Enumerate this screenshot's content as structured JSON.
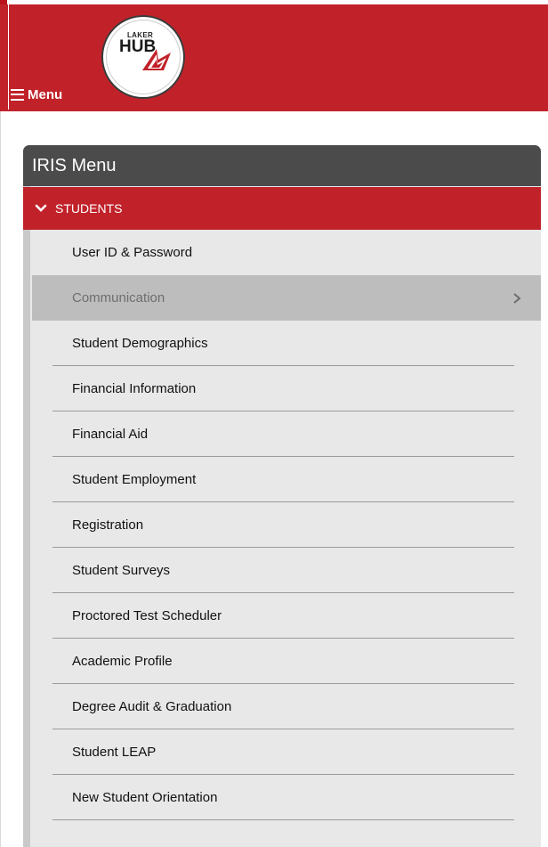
{
  "header": {
    "menu_label": "Menu",
    "logo": {
      "top_text": "LAKER",
      "main_text": "HUB"
    },
    "colors": {
      "brand_red": "#c1222a",
      "white": "#ffffff"
    }
  },
  "panel": {
    "title": "IRIS Menu",
    "section": {
      "label": "STUDENTS",
      "expanded": true
    },
    "items": [
      {
        "label": "User ID & Password"
      },
      {
        "label": "Communication",
        "active": true
      },
      {
        "label": "Student Demographics"
      },
      {
        "label": "Financial Information"
      },
      {
        "label": "Financial Aid"
      },
      {
        "label": "Student Employment"
      },
      {
        "label": "Registration"
      },
      {
        "label": "Student Surveys"
      },
      {
        "label": "Proctored Test Scheduler"
      },
      {
        "label": "Academic Profile"
      },
      {
        "label": "Degree Audit & Graduation"
      },
      {
        "label": "Student LEAP"
      },
      {
        "label": "New Student Orientation"
      }
    ],
    "colors": {
      "header_bg": "#4b4b4b",
      "list_bg": "#e8e8e8",
      "active_bg": "#bdbdbd"
    }
  },
  "icons": {
    "menu": "hamburger-icon",
    "expand": "chevron-down-icon",
    "submenu": "chevron-right-icon"
  }
}
